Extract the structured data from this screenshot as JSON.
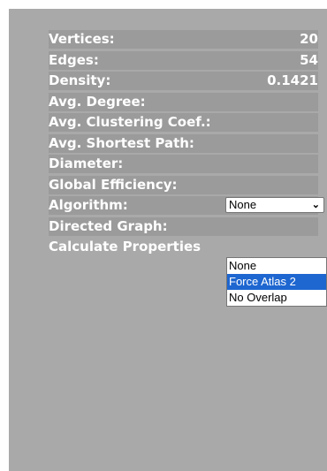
{
  "stats": {
    "vertices": {
      "label": "Vertices:",
      "value": "20"
    },
    "edges": {
      "label": "Edges:",
      "value": "54"
    },
    "density": {
      "label": "Density:",
      "value": "0.1421"
    },
    "avg_degree": {
      "label": "Avg. Degree:"
    },
    "avg_clustering": {
      "label": "Avg. Clustering Coef.:"
    },
    "avg_shortest_path": {
      "label": "Avg. Shortest Path:"
    },
    "diameter": {
      "label": "Diameter:"
    },
    "global_efficiency": {
      "label": "Global Efficiency:"
    }
  },
  "algorithm": {
    "label": "Algorithm:",
    "selected": "None",
    "options": [
      "None",
      "Force Atlas 2",
      "No Overlap"
    ],
    "highlighted_index": 1
  },
  "directed_graph": {
    "label": "Directed Graph:"
  },
  "calculate_properties": {
    "label": "Calculate Properties"
  },
  "colors": {
    "panel": "#a9a9a9",
    "highlight": "#1e66d0",
    "text": "#ffffff"
  }
}
